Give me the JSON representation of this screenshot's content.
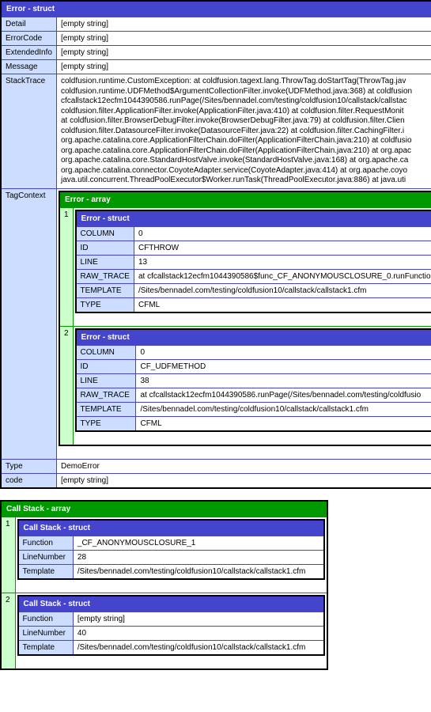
{
  "error": {
    "header": "Error - struct",
    "Detail": "[empty string]",
    "ErrorCode": "[empty string]",
    "ExtendedInfo": "[empty string]",
    "Message": "[empty string]",
    "StackTrace": "coldfusion.runtime.CustomException: at coldfusion.tagext.lang.ThrowTag.doStartTag(ThrowTag.jav\ncoldfusion.runtime.UDFMethod$ArgumentCollectionFilter.invoke(UDFMethod.java:368) at coldfusion\ncfcallstack12ecfm1044390586.runPage(/Sites/bennadel.com/testing/coldfusion10/callstack/callstac\ncoldfusion.filter.ApplicationFilter.invoke(ApplicationFilter.java:410) at coldfusion.filter.RequestMonit\nat coldfusion.filter.BrowserDebugFilter.invoke(BrowserDebugFilter.java:79) at coldfusion.filter.Clien\ncoldfusion.filter.DatasourceFilter.invoke(DatasourceFilter.java:22) at coldfusion.filter.CachingFilter.i\norg.apache.catalina.core.ApplicationFilterChain.doFilter(ApplicationFilterChain.java:210) at coldfusio\norg.apache.catalina.core.ApplicationFilterChain.doFilter(ApplicationFilterChain.java:210) at org.apac\norg.apache.catalina.core.StandardHostValve.invoke(StandardHostValve.java:168) at org.apache.ca\norg.apache.catalina.connector.CoyoteAdapter.service(CoyoteAdapter.java:414) at org.apache.coyo\njava.util.concurrent.ThreadPoolExecutor$Worker.runTask(ThreadPoolExecutor.java:886) at java.uti",
    "Type": "DemoError",
    "code": "[empty string]",
    "TagContext": {
      "header": "Error - array",
      "items": [
        {
          "idx": "1",
          "header": "Error - struct",
          "COLUMN": "0",
          "ID": "CFTHROW",
          "LINE": "13",
          "RAW_TRACE": "at cfcallstack12ecfm1044390586$func_CF_ANONYMOUSCLOSURE_0.runFunctio",
          "TEMPLATE": "/Sites/bennadel.com/testing/coldfusion10/callstack/callstack1.cfm",
          "TYPE": "CFML"
        },
        {
          "idx": "2",
          "header": "Error - struct",
          "COLUMN": "0",
          "ID": "CF_UDFMETHOD",
          "LINE": "38",
          "RAW_TRACE": "at cfcallstack12ecfm1044390586.runPage(/Sites/bennadel.com/testing/coldfusio",
          "TEMPLATE": "/Sites/bennadel.com/testing/coldfusion10/callstack/callstack1.cfm",
          "TYPE": "CFML"
        }
      ]
    }
  },
  "callstack": {
    "header": "Call Stack - array",
    "items": [
      {
        "idx": "1",
        "header": "Call Stack - struct",
        "Function": "_CF_ANONYMOUSCLOSURE_1",
        "LineNumber": "28",
        "Template": "/Sites/bennadel.com/testing/coldfusion10/callstack/callstack1.cfm"
      },
      {
        "idx": "2",
        "header": "Call Stack - struct",
        "Function": "[empty string]",
        "LineNumber": "40",
        "Template": "/Sites/bennadel.com/testing/coldfusion10/callstack/callstack1.cfm"
      }
    ]
  },
  "labels": {
    "Detail": "Detail",
    "ErrorCode": "ErrorCode",
    "ExtendedInfo": "ExtendedInfo",
    "Message": "Message",
    "StackTrace": "StackTrace",
    "TagContext": "TagContext",
    "Type": "Type",
    "code": "code",
    "COLUMN": "COLUMN",
    "ID": "ID",
    "LINE": "LINE",
    "RAW_TRACE": "RAW_TRACE",
    "TEMPLATE": "TEMPLATE",
    "TYPE": "TYPE",
    "Function": "Function",
    "LineNumber": "LineNumber",
    "Template": "Template"
  }
}
